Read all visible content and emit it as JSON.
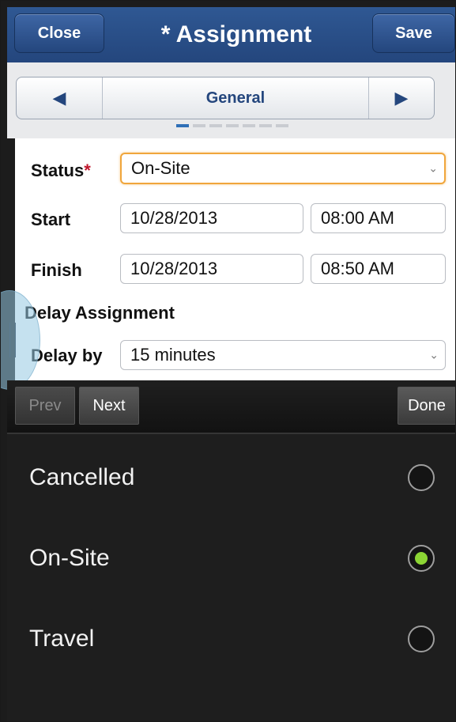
{
  "header": {
    "close_label": "Close",
    "title": "* Assignment",
    "save_label": "Save"
  },
  "tabs": {
    "current": "General",
    "prev_icon": "triangle-left",
    "next_icon": "triangle-right",
    "page_count": 7,
    "active_index": 0
  },
  "form": {
    "status_label": "Status",
    "required_marker": "*",
    "status_value": "On-Site",
    "start_label": "Start",
    "start_date": "10/28/2013",
    "start_time": "08:00 AM",
    "finish_label": "Finish",
    "finish_date": "10/28/2013",
    "finish_time": "08:50 AM",
    "section_title": "Delay Assignment",
    "delay_label": "Delay by",
    "delay_value": "15 minutes"
  },
  "keyboard_bar": {
    "prev_label": "Prev",
    "next_label": "Next",
    "done_label": "Done"
  },
  "picker": {
    "options": [
      {
        "label": "Cancelled",
        "selected": false
      },
      {
        "label": "On-Site",
        "selected": true
      },
      {
        "label": "Travel",
        "selected": false
      }
    ]
  },
  "colors": {
    "header": "#24467d",
    "accent": "#8cd534",
    "focus": "#f0a63c"
  }
}
